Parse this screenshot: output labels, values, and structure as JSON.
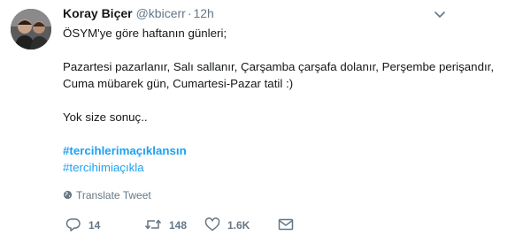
{
  "tweet": {
    "author": {
      "fullname": "Koray Biçer",
      "username": "@kbicerr",
      "separator": "·",
      "time": "12h"
    },
    "text_lines": [
      "ÖSYM'ye göre haftanın günleri;",
      "",
      "Pazartesi pazarlanır, Salı sallanır, Çarşamba çarşafa dolanır, Perşembe perişandır,",
      "Cuma mübarek gün, Cumartesi-Pazar tatil :)",
      "",
      "Yok size sonuç.."
    ],
    "hashtags": [
      "#tercihlerimaçıklansın",
      "#tercihimiaçıkla"
    ],
    "translate_label": "Translate Tweet",
    "actions": {
      "reply_count": "14",
      "retweet_count": "148",
      "like_count": "1.6K"
    },
    "icons": {
      "caret": "chevron-down-icon",
      "translate": "globe-icon",
      "reply": "reply-icon",
      "retweet": "retweet-icon",
      "like": "heart-icon",
      "dm": "envelope-icon"
    },
    "colors": {
      "text": "#14171a",
      "secondary": "#657786",
      "link": "#1da1f2"
    }
  }
}
